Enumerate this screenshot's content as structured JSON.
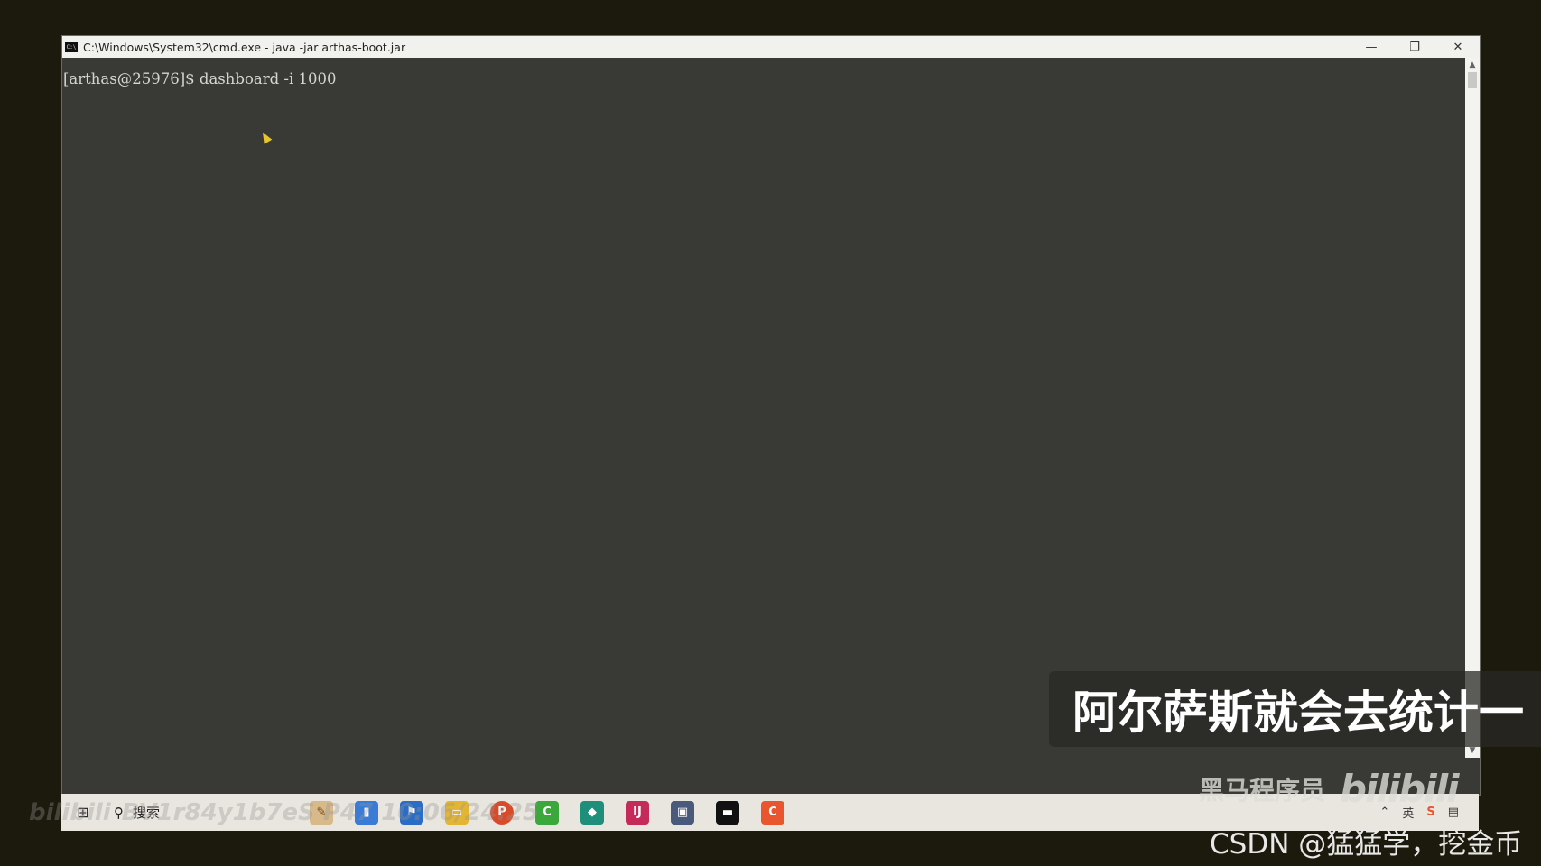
{
  "window": {
    "title": "C:\\Windows\\System32\\cmd.exe - java  -jar arthas-boot.jar",
    "controls": {
      "minimize": "—",
      "restore": "❐",
      "close": "✕"
    }
  },
  "console": {
    "prompt": "[arthas@25976]$",
    "command": "dashboard -i 1000"
  },
  "taskbar": {
    "search_label": "搜索"
  },
  "overlay": {
    "subtitle": "阿尔萨斯就会去统计一",
    "brand": "黑马程序员",
    "brand_logo": "bilibili",
    "csdn": "CSDN @猛猛学，挖金币",
    "bili_watermark": "bilibili",
    "bili_video_id": "BV1r84y1b7eS P47 10:06/24:25"
  }
}
